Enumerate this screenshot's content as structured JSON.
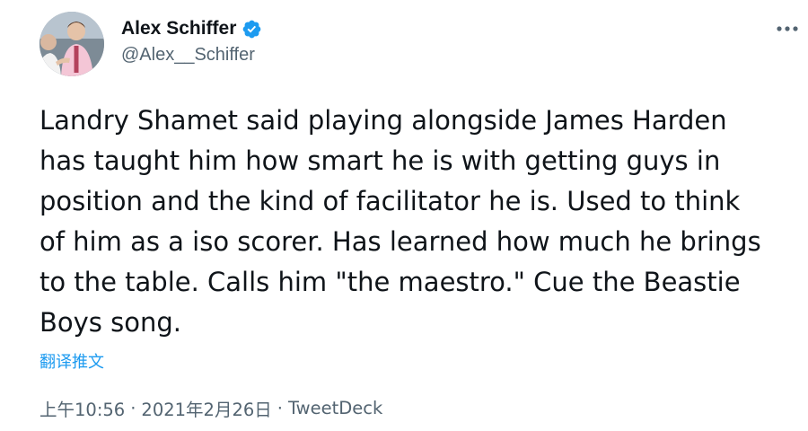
{
  "author": {
    "display_name": "Alex Schiffer",
    "handle": "@Alex__Schiffer",
    "verified": true,
    "verified_color": "#1d9bf0"
  },
  "tweet": {
    "lines": [
      "Landry Shamet said playing alongside James Harden",
      "has taught him how smart he is with getting guys in",
      "position and the kind of facilitator he is. Used to think",
      "of him as a iso scorer. Has learned how much he brings",
      "to the table. Calls him \"the maestro.\" Cue the Beastie",
      "Boys song."
    ],
    "translate_label": "翻译推文",
    "time": "上午10:56",
    "separator": "·",
    "date": "2021年2月26日",
    "source": "TweetDeck"
  },
  "icons": {
    "more": "more-horizontal-icon",
    "verified": "verified-badge-icon"
  },
  "colors": {
    "text": "#0f1419",
    "secondary": "#536471",
    "link": "#1d9bf0"
  }
}
